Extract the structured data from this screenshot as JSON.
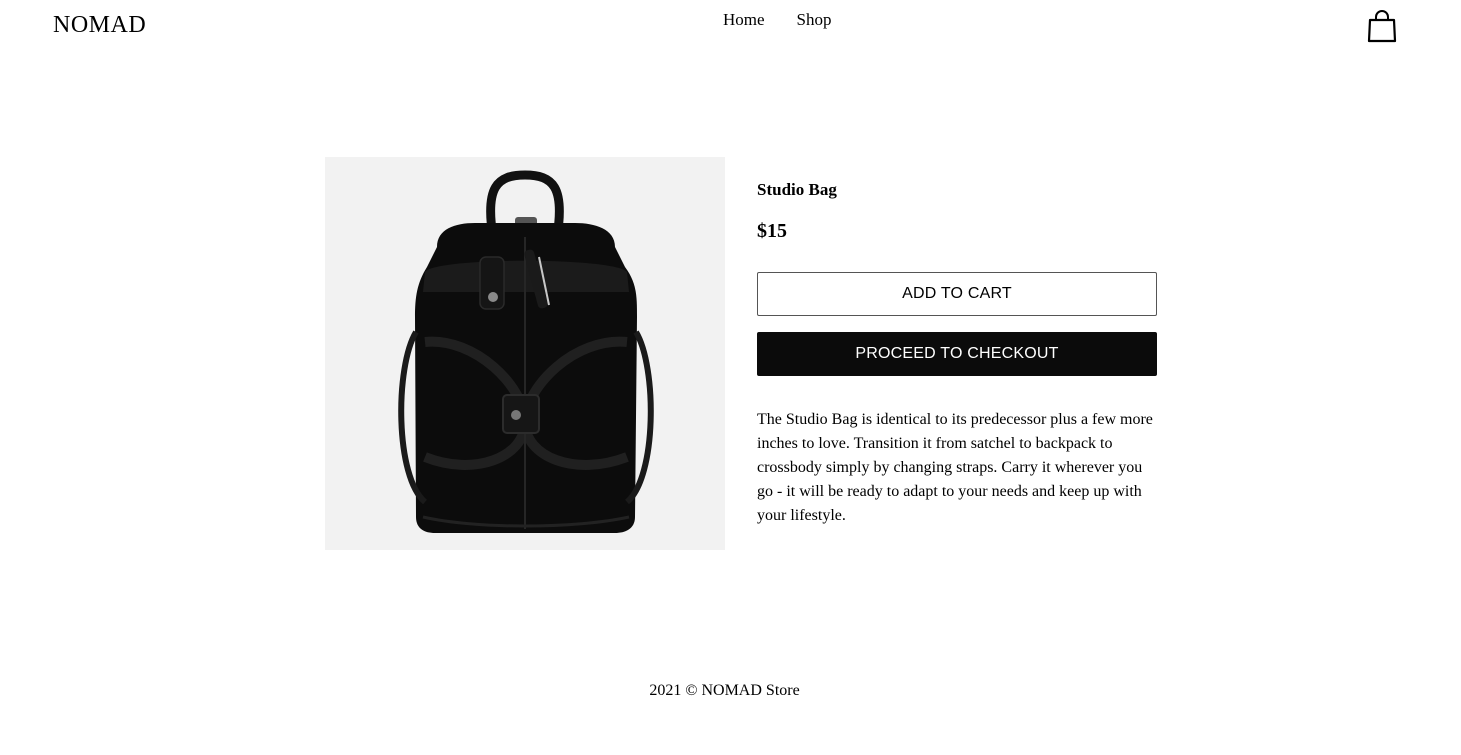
{
  "header": {
    "logo": "NOMAD",
    "nav": [
      {
        "label": "Home"
      },
      {
        "label": "Shop"
      }
    ],
    "cart_icon": "shopping-bag-icon"
  },
  "product": {
    "image_icon": "backpack-image",
    "title": "Studio Bag",
    "price": "$15",
    "add_to_cart_label": "ADD TO CART",
    "checkout_label": "PROCEED TO CHECKOUT",
    "description": "The Studio Bag is identical to its predecessor plus a few more inches to love. Transition it from satchel to backpack to crossbody simply by changing straps. Carry it wherever you go - it will be ready to adapt to your needs and keep up with your lifestyle."
  },
  "footer": {
    "text": "2021 © NOMAD Store"
  },
  "colors": {
    "image_background": "#f2f2f2",
    "checkout_button": "#0b0b0b",
    "text": "#000000"
  }
}
